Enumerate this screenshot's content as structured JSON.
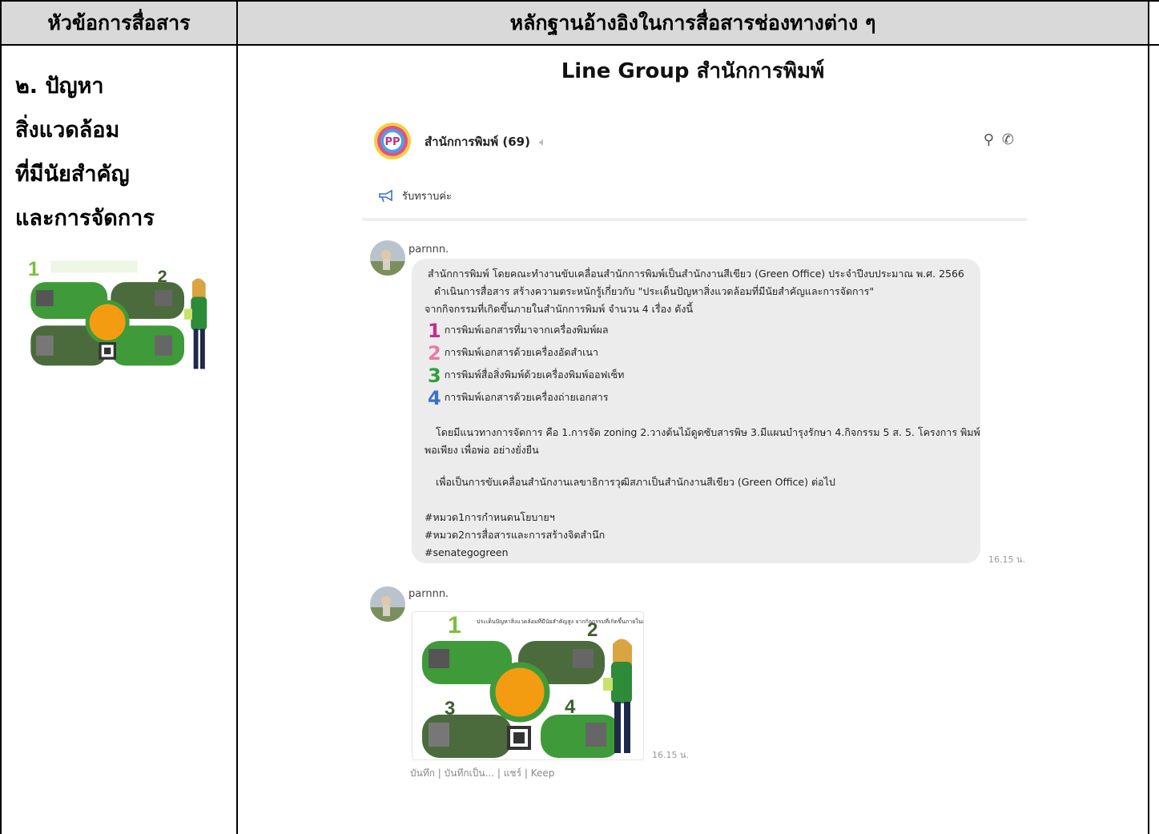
{
  "table": {
    "header_col1": "หัวข้อการสื่อสาร",
    "header_col2": "หลักฐานอ้างอิงในการสื่อสารช่องทางต่าง ๆ",
    "topic_lines": [
      "๒. ปัญหา",
      "สิ่งแวดล้อม",
      "ที่มีนัยสำคัญ",
      "และการจัดการ"
    ],
    "evidence_title": "Line Group สำนักการพิมพ์"
  },
  "chat": {
    "group_name": "สำนักการพิมพ์ (69)",
    "group_logo_text": "PP",
    "announcement": "รับทราบค่ะ",
    "messages": [
      {
        "sender": "parnnn.",
        "time": "16.15 น.",
        "lines": [
          "สำนักการพิมพ์ โดยคณะทำงานขับเคลื่อนสำนักการพิมพ์เป็นสำนักงานสีเขียว (Green Office) ประจำปีงบประมาณ พ.ศ. 2566",
          "ดำเนินการสื่อสาร สร้างความตระหนักรู้เกี่ยวกับ \"ประเด็นปัญหาสิ่งแวดล้อมที่มีนัยสำคัญและการจัดการ\"",
          "จากกิจกรรมที่เกิดขึ้นภายในสำนักการพิมพ์ จำนวน 4 เรื่อง ดังนี้"
        ],
        "items": [
          {
            "num": "1",
            "color": "#c0308c",
            "text": "การพิมพ์เอกสารที่มาจากเครื่องพิมพ์ผล"
          },
          {
            "num": "2",
            "color": "#e87aa6",
            "text": "การพิมพ์เอกสารด้วยเครื่องอัดสำเนา"
          },
          {
            "num": "3",
            "color": "#2e9e3e",
            "text": "การพิมพ์สื่อสิ่งพิมพ์ด้วยเครื่องพิมพ์ออฟเซ็ท"
          },
          {
            "num": "4",
            "color": "#3d6fd1",
            "text": "การพิมพ์เอกสารด้วยเครื่องถ่ายเอกสาร"
          }
        ],
        "para1_a": "โดยมีแนวทางการจัดการ คือ 1.การจัด zoning 2.วางต้นไม้ดูดซับสารพิษ 3.มีแผนบำรุงรักษา 4.กิจกรรม 5 ส. 5. โครงการ พิมพ์",
        "para1_b": "พอเพียง เพื่อพ่อ อย่างยั่งยืน",
        "para2": "เพื่อเป็นการขับเคลื่อนสำนักงานเลขาธิการวุฒิสภาเป็นสำนักงานสีเขียว (Green Office) ต่อไป",
        "hashtags": [
          "#หมวด1การกำหนดนโยบายฯ",
          "#หมวด2การสื่อสารและการสร้างจิตสำนึก",
          "#senategogreen"
        ]
      },
      {
        "sender": "parnnn.",
        "time": "16.15 น.",
        "image_caption": "ประเด็นปัญหาสิ่งแวดล้อมที่มีนัยสำคัญสูง จากกิจกรรมที่เกิดขึ้นภายในสำนักการพิมพ์",
        "actions": "บันทึก | บันทึกเป็น... | แชร์ | Keep"
      }
    ]
  },
  "colors": {
    "header_bg": "#d9d9d9",
    "bubble_bg": "#ececec",
    "infographic_green": "#3f9a3a",
    "infographic_orange": "#f39c12"
  }
}
